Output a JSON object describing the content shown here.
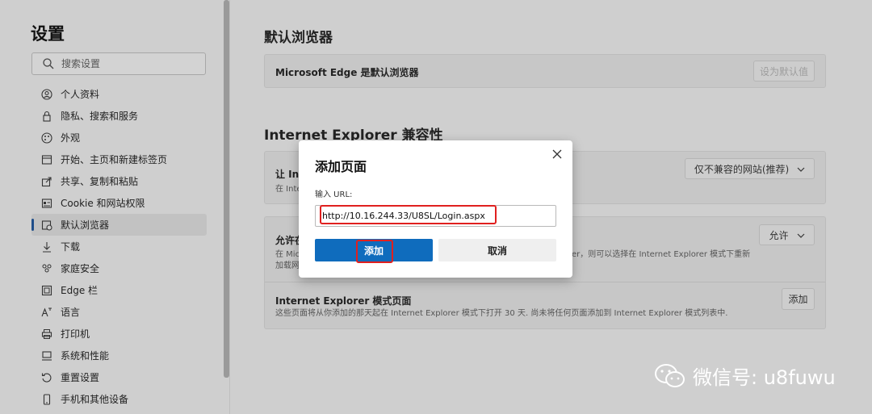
{
  "sidebar": {
    "title": "设置",
    "search_placeholder": "搜索设置",
    "items": [
      {
        "label": "个人资料",
        "icon": "profile-icon"
      },
      {
        "label": "隐私、搜索和服务",
        "icon": "lock-icon"
      },
      {
        "label": "外观",
        "icon": "appearance-icon"
      },
      {
        "label": "开始、主页和新建标签页",
        "icon": "home-tab-icon"
      },
      {
        "label": "共享、复制和粘贴",
        "icon": "share-icon"
      },
      {
        "label": "Cookie 和网站权限",
        "icon": "cookie-permissions-icon"
      },
      {
        "label": "默认浏览器",
        "icon": "default-browser-icon",
        "active": true
      },
      {
        "label": "下载",
        "icon": "download-icon"
      },
      {
        "label": "家庭安全",
        "icon": "family-icon"
      },
      {
        "label": "Edge 栏",
        "icon": "edge-bar-icon"
      },
      {
        "label": "语言",
        "icon": "language-icon"
      },
      {
        "label": "打印机",
        "icon": "printer-icon"
      },
      {
        "label": "系统和性能",
        "icon": "system-icon"
      },
      {
        "label": "重置设置",
        "icon": "reset-icon"
      },
      {
        "label": "手机和其他设备",
        "icon": "phone-icon"
      }
    ]
  },
  "main": {
    "default_browser": {
      "heading": "默认浏览器",
      "row_title": "Microsoft Edge 是默认浏览器",
      "button": "设为默认值"
    },
    "ie_compat": {
      "heading": "Internet Explorer 兼容性",
      "row1_title": "让 Int",
      "row1_desc": "在 Inte",
      "row1_select": "仅不兼容的网站(推荐)",
      "row2_title": "允许在",
      "row2_desc_left": "在 Mic",
      "row2_desc_right": "er，则可以选择在 Internet Explorer 模式下重新",
      "row2_desc_line2": "加载网",
      "row2_select": "允许",
      "row3_title": "Internet Explorer 模式页面",
      "row3_desc": "这些页面将从你添加的那天起在 Internet Explorer 模式下打开 30 天. 尚未将任何页面添加到 Internet Explorer 模式列表中.",
      "row3_button": "添加"
    }
  },
  "dialog": {
    "title": "添加页面",
    "label": "输入 URL:",
    "url_value": "http://10.16.244.33/U8SL/Login.aspx",
    "add_button": "添加",
    "cancel_button": "取消"
  },
  "watermark": {
    "text": "微信号: u8fuwu",
    "icon": "wechat-icon"
  },
  "colors": {
    "primary": "#0f6cbd",
    "highlight": "#e0201f",
    "overlay_bg": "#cfcfcf"
  }
}
